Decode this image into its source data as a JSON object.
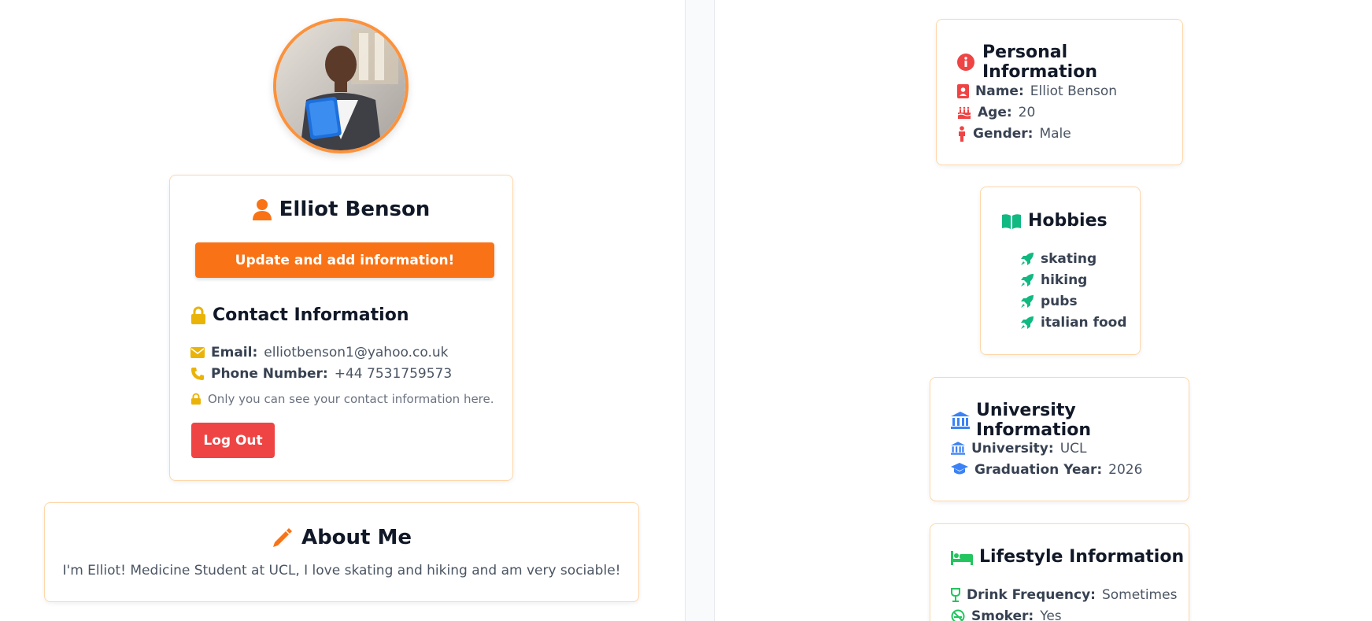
{
  "profile": {
    "name": "Elliot Benson",
    "update_button": "Update and add information!",
    "contact_title": "Contact Information",
    "email_label": "Email:",
    "email": "elliotbenson1@yahoo.co.uk",
    "phone_label": "Phone Number:",
    "phone": "+44 7531759573",
    "privacy_note": "Only you can see your contact information here.",
    "logout_button": "Log Out"
  },
  "about": {
    "title": "About Me",
    "text": "I'm Elliot! Medicine Student at UCL, I love skating and hiking and am very sociable!"
  },
  "personal": {
    "title": "Personal Information",
    "name_label": "Name:",
    "name": "Elliot Benson",
    "age_label": "Age:",
    "age": "20",
    "gender_label": "Gender:",
    "gender": "Male"
  },
  "hobbies": {
    "title": "Hobbies",
    "items": [
      "skating",
      "hiking",
      "pubs",
      "italian food"
    ]
  },
  "university": {
    "title": "University Information",
    "university_label": "University:",
    "university": "UCL",
    "grad_label": "Graduation Year:",
    "grad_year": "2026"
  },
  "lifestyle": {
    "title": "Lifestyle Information",
    "drink_label": "Drink Frequency:",
    "drink": "Sometimes",
    "smoker_label": "Smoker:",
    "smoker": "Yes"
  },
  "colors": {
    "orange": "#f97316",
    "amber": "#eab308",
    "red": "#ef4444",
    "green": "#10b981",
    "blue": "#3b82f6"
  },
  "icons": [
    "user-icon",
    "lock-icon",
    "envelope-icon",
    "phone-icon",
    "pencil-icon",
    "info-icon",
    "id-card-icon",
    "cake-icon",
    "person-icon",
    "book-icon",
    "rocket-icon",
    "bank-icon",
    "graduation-cap-icon",
    "bed-icon",
    "glass-icon",
    "no-smoking-icon"
  ]
}
